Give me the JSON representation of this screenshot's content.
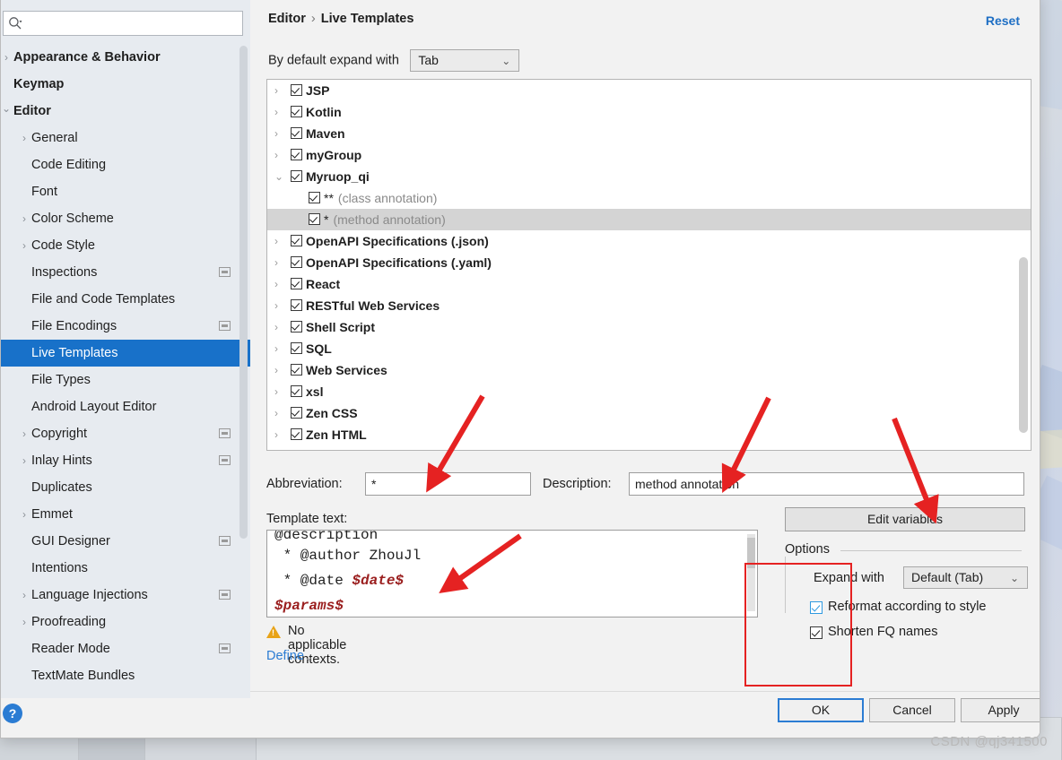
{
  "window": {
    "watermark": "CSDN @qj341500"
  },
  "sidebar": {
    "search": {
      "placeholder": "",
      "value": "",
      "icon": "search-icon"
    },
    "items": [
      {
        "label": "Appearance & Behavior",
        "indent": 14,
        "arrow": ">",
        "bold": true,
        "badge": false,
        "selected": false
      },
      {
        "label": "Keymap",
        "indent": 14,
        "arrow": "",
        "bold": true,
        "badge": false,
        "selected": false
      },
      {
        "label": "Editor",
        "indent": 14,
        "arrow": "v",
        "bold": true,
        "badge": false,
        "selected": false
      },
      {
        "label": "General",
        "indent": 34,
        "arrow": ">",
        "bold": false,
        "badge": false,
        "selected": false
      },
      {
        "label": "Code Editing",
        "indent": 34,
        "arrow": "",
        "bold": false,
        "badge": false,
        "selected": false
      },
      {
        "label": "Font",
        "indent": 34,
        "arrow": "",
        "bold": false,
        "badge": false,
        "selected": false
      },
      {
        "label": "Color Scheme",
        "indent": 34,
        "arrow": ">",
        "bold": false,
        "badge": false,
        "selected": false
      },
      {
        "label": "Code Style",
        "indent": 34,
        "arrow": ">",
        "bold": false,
        "badge": false,
        "selected": false
      },
      {
        "label": "Inspections",
        "indent": 34,
        "arrow": "",
        "bold": false,
        "badge": true,
        "selected": false
      },
      {
        "label": "File and Code Templates",
        "indent": 34,
        "arrow": "",
        "bold": false,
        "badge": false,
        "selected": false
      },
      {
        "label": "File Encodings",
        "indent": 34,
        "arrow": "",
        "bold": false,
        "badge": true,
        "selected": false
      },
      {
        "label": "Live Templates",
        "indent": 34,
        "arrow": "",
        "bold": false,
        "badge": false,
        "selected": true
      },
      {
        "label": "File Types",
        "indent": 34,
        "arrow": "",
        "bold": false,
        "badge": false,
        "selected": false
      },
      {
        "label": "Android Layout Editor",
        "indent": 34,
        "arrow": "",
        "bold": false,
        "badge": false,
        "selected": false
      },
      {
        "label": "Copyright",
        "indent": 34,
        "arrow": ">",
        "bold": false,
        "badge": true,
        "selected": false
      },
      {
        "label": "Inlay Hints",
        "indent": 34,
        "arrow": ">",
        "bold": false,
        "badge": true,
        "selected": false
      },
      {
        "label": "Duplicates",
        "indent": 34,
        "arrow": "",
        "bold": false,
        "badge": false,
        "selected": false
      },
      {
        "label": "Emmet",
        "indent": 34,
        "arrow": ">",
        "bold": false,
        "badge": false,
        "selected": false
      },
      {
        "label": "GUI Designer",
        "indent": 34,
        "arrow": "",
        "bold": false,
        "badge": true,
        "selected": false
      },
      {
        "label": "Intentions",
        "indent": 34,
        "arrow": "",
        "bold": false,
        "badge": false,
        "selected": false
      },
      {
        "label": "Language Injections",
        "indent": 34,
        "arrow": ">",
        "bold": false,
        "badge": true,
        "selected": false
      },
      {
        "label": "Proofreading",
        "indent": 34,
        "arrow": ">",
        "bold": false,
        "badge": false,
        "selected": false
      },
      {
        "label": "Reader Mode",
        "indent": 34,
        "arrow": "",
        "bold": false,
        "badge": true,
        "selected": false
      },
      {
        "label": "TextMate Bundles",
        "indent": 34,
        "arrow": "",
        "bold": false,
        "badge": false,
        "selected": false
      }
    ],
    "help_label": "?"
  },
  "header": {
    "breadcrumb_root": "Editor",
    "breadcrumb_sep": "›",
    "breadcrumb_leaf": "Live Templates",
    "reset_label": "Reset"
  },
  "expand_row": {
    "label": "By default expand with",
    "value": "Tab",
    "chevron": "⌄"
  },
  "template_tree": {
    "rows": [
      {
        "label": "JSP",
        "child": false,
        "arrow": ">",
        "selected": false,
        "suffix": ""
      },
      {
        "label": "Kotlin",
        "child": false,
        "arrow": ">",
        "selected": false,
        "suffix": ""
      },
      {
        "label": "Maven",
        "child": false,
        "arrow": ">",
        "selected": false,
        "suffix": ""
      },
      {
        "label": "myGroup",
        "child": false,
        "arrow": ">",
        "selected": false,
        "suffix": ""
      },
      {
        "label": "Myruop_qi",
        "child": false,
        "arrow": "v",
        "selected": false,
        "suffix": ""
      },
      {
        "label": "**",
        "child": true,
        "arrow": "",
        "selected": false,
        "suffix": "(class annotation)"
      },
      {
        "label": "*",
        "child": true,
        "arrow": "",
        "selected": true,
        "suffix": "(method annotation)"
      },
      {
        "label": "OpenAPI Specifications (.json)",
        "child": false,
        "arrow": ">",
        "selected": false,
        "suffix": ""
      },
      {
        "label": "OpenAPI Specifications (.yaml)",
        "child": false,
        "arrow": ">",
        "selected": false,
        "suffix": ""
      },
      {
        "label": "React",
        "child": false,
        "arrow": ">",
        "selected": false,
        "suffix": ""
      },
      {
        "label": "RESTful Web Services",
        "child": false,
        "arrow": ">",
        "selected": false,
        "suffix": ""
      },
      {
        "label": "Shell Script",
        "child": false,
        "arrow": ">",
        "selected": false,
        "suffix": ""
      },
      {
        "label": "SQL",
        "child": false,
        "arrow": ">",
        "selected": false,
        "suffix": ""
      },
      {
        "label": "Web Services",
        "child": false,
        "arrow": ">",
        "selected": false,
        "suffix": ""
      },
      {
        "label": "xsl",
        "child": false,
        "arrow": ">",
        "selected": false,
        "suffix": ""
      },
      {
        "label": "Zen CSS",
        "child": false,
        "arrow": ">",
        "selected": false,
        "suffix": ""
      },
      {
        "label": "Zen HTML",
        "child": false,
        "arrow": ">",
        "selected": false,
        "suffix": ""
      }
    ],
    "toolbar": [
      {
        "icon": "plus-icon",
        "glyph": "＋"
      },
      {
        "icon": "minus-icon",
        "glyph": "−"
      },
      {
        "icon": "duplicate-icon",
        "glyph": "❐"
      },
      {
        "icon": "revert-icon",
        "glyph": "↩"
      }
    ]
  },
  "fields": {
    "abbreviation_label": "Abbreviation:",
    "abbreviation_value": "*",
    "description_label": "Description:",
    "description_value": "method annotation",
    "edit_variables_label": "Edit variables",
    "template_text_label": "Template text:"
  },
  "template_text": {
    "lines": [
      {
        "text": "@description",
        "var": "",
        "cut": true
      },
      {
        "text": " * @author ZhouJl",
        "var": "",
        "cut": false
      },
      {
        "text": " * @date ",
        "var": "$date$",
        "cut": false
      },
      {
        "text": "",
        "var": "$params$",
        "cut": false
      }
    ]
  },
  "options": {
    "title": "Options",
    "expand_with_label": "Expand with",
    "expand_with_value": "Default (Tab)",
    "chevron": "⌄",
    "checkboxes": [
      {
        "label": "Reformat according to style",
        "checked": true,
        "accent": true
      },
      {
        "label": "Shorten FQ names",
        "checked": true,
        "accent": false
      }
    ]
  },
  "context": {
    "warning_text": "No applicable contexts.",
    "define_label": "Define",
    "define_chevron": "⌄"
  },
  "buttons": {
    "ok": "OK",
    "cancel": "Cancel",
    "apply": "Apply"
  },
  "colors": {
    "accent": "#1871c9",
    "link": "#2b7cd3",
    "annotation": "#e52222",
    "warning": "#e8a317",
    "template_var": "#9b2020"
  }
}
